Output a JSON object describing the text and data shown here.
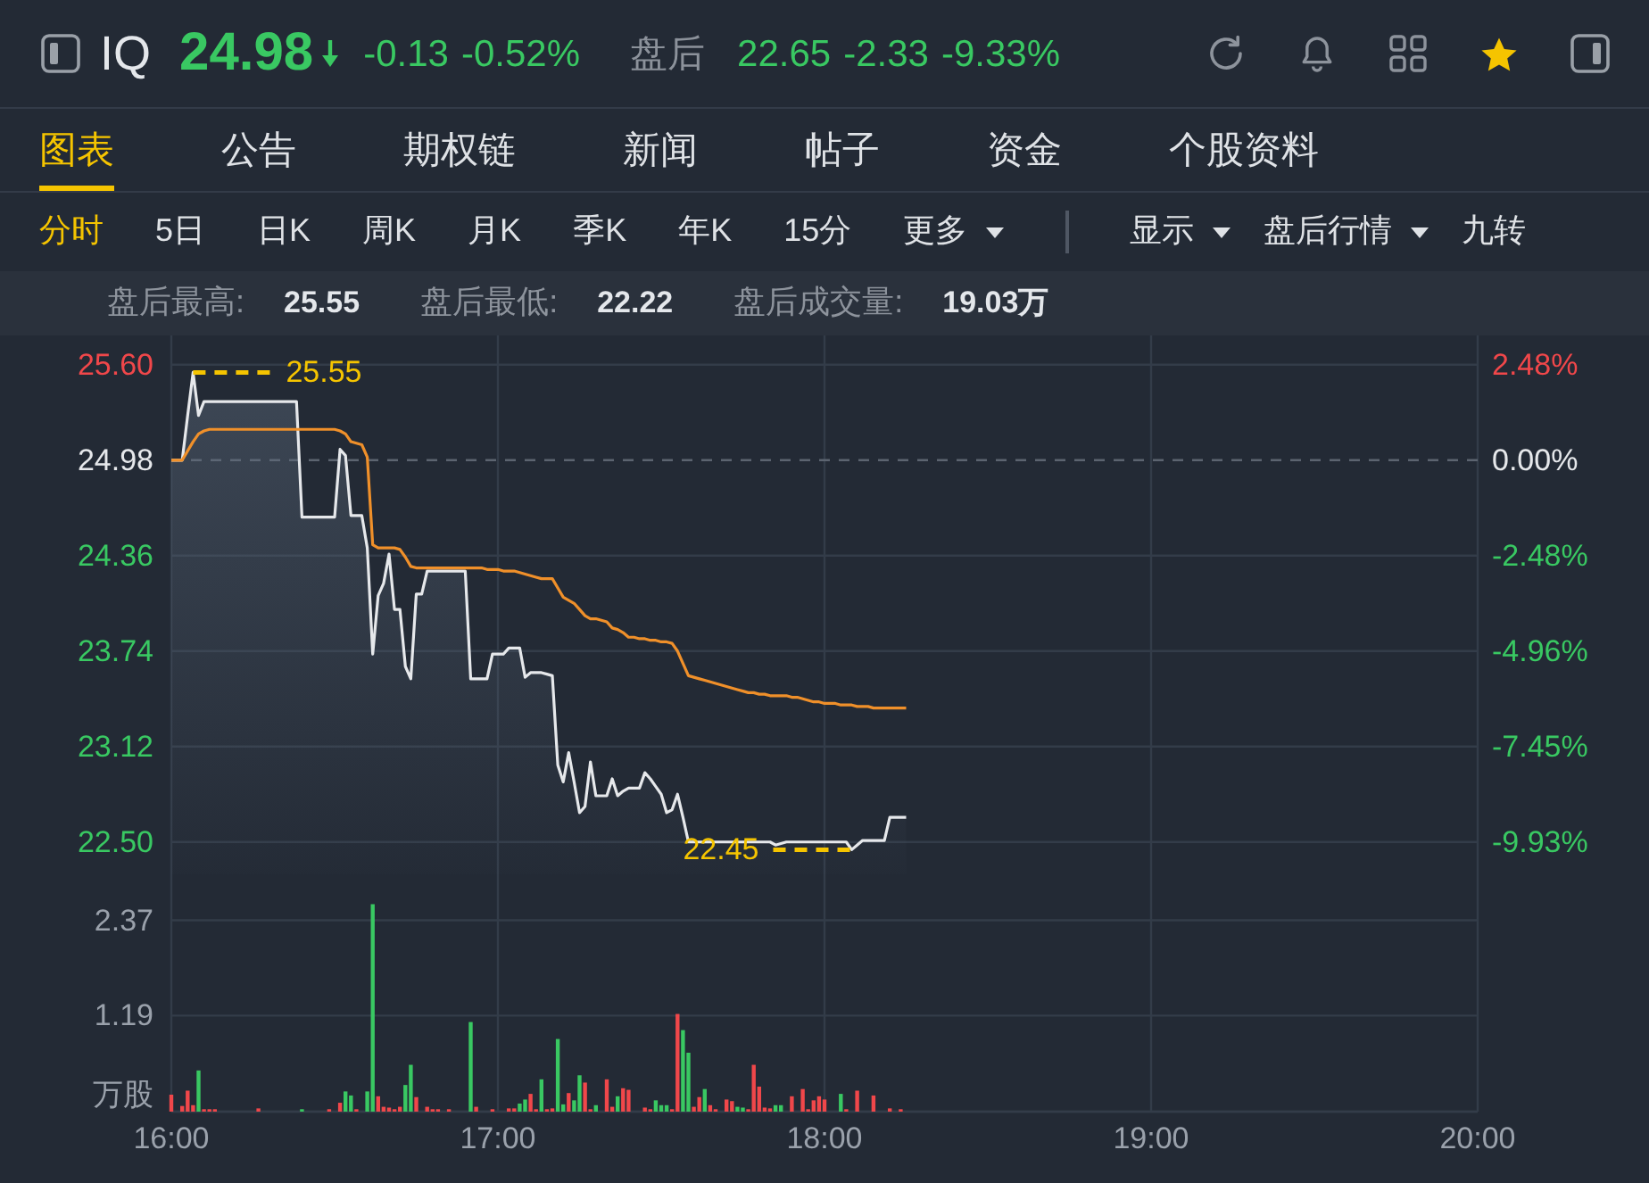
{
  "quote": {
    "symbol": "IQ",
    "price": "24.98",
    "rising": false,
    "change": "-0.13",
    "change_percent": "-0.52%",
    "after_hours_label": "盘后",
    "after_hours_price": "22.65",
    "after_hours_rising": false,
    "after_hours_change": "-2.33",
    "after_hours_change_percent": "-9.33%",
    "favorited": true
  },
  "tabs": [
    {
      "label": "图表",
      "selected": true
    },
    {
      "label": "公告",
      "selected": false
    },
    {
      "label": "期权链",
      "selected": false
    },
    {
      "label": "新闻",
      "selected": false
    },
    {
      "label": "帖子",
      "selected": false
    },
    {
      "label": "资金",
      "selected": false
    },
    {
      "label": "个股资料",
      "selected": false
    }
  ],
  "periods": [
    {
      "label": "分时",
      "selected": true,
      "dropdown": false
    },
    {
      "label": "5日",
      "selected": false,
      "dropdown": false
    },
    {
      "label": "日K",
      "selected": false,
      "dropdown": false
    },
    {
      "label": "周K",
      "selected": false,
      "dropdown": false
    },
    {
      "label": "月K",
      "selected": false,
      "dropdown": false
    },
    {
      "label": "季K",
      "selected": false,
      "dropdown": false
    },
    {
      "label": "年K",
      "selected": false,
      "dropdown": false
    },
    {
      "label": "15分",
      "selected": false,
      "dropdown": false
    },
    {
      "label": "更多",
      "selected": false,
      "dropdown": true
    }
  ],
  "options": [
    {
      "label": "显示",
      "dropdown": true
    },
    {
      "label": "盘后行情",
      "dropdown": true
    },
    {
      "label": "九转",
      "dropdown": false
    }
  ],
  "stats": [
    {
      "label": "盘后最高:",
      "value": "25.55"
    },
    {
      "label": "盘后最低:",
      "value": "22.22"
    },
    {
      "label": "盘后成交量:",
      "value": "19.03万"
    }
  ],
  "price_chart": {
    "percent_labels": [
      "2.48%",
      "0.00%",
      "-2.48%",
      "-4.96%",
      "-7.45%",
      "-9.93%"
    ],
    "chart_data": {
      "type": "line",
      "grid": true,
      "categories": [
        null,
        null,
        null,
        null,
        null,
        null,
        null,
        null,
        null,
        null,
        null,
        null,
        null,
        null,
        null,
        null,
        null,
        null,
        null,
        null,
        null,
        null,
        null,
        null,
        null,
        null,
        null,
        null,
        null,
        null,
        null,
        null,
        null,
        null,
        null,
        null,
        null,
        null,
        null,
        null,
        null,
        null,
        null,
        null,
        null,
        null,
        null,
        null,
        null,
        null,
        null,
        null,
        null,
        null,
        null,
        null,
        null,
        null,
        null,
        null,
        null,
        null,
        null,
        null,
        null,
        null,
        null,
        null,
        null,
        null,
        null,
        null,
        null,
        null,
        null,
        null,
        null,
        null,
        null,
        null,
        null,
        null,
        null,
        null,
        null,
        null,
        null,
        null,
        null,
        null,
        null,
        null,
        null,
        null,
        null,
        null,
        null,
        null,
        null,
        null,
        null,
        null,
        null,
        null,
        null,
        null,
        null,
        null,
        null,
        null,
        null,
        null,
        null,
        null,
        null,
        null,
        null,
        null,
        null,
        null,
        null,
        null,
        null,
        null,
        null,
        null,
        null,
        null,
        null,
        null,
        null,
        null,
        null,
        null,
        null,
        null,
        null,
        null,
        null,
        null,
        null,
        null,
        null,
        null,
        null,
        null,
        null,
        null,
        null,
        null,
        null,
        null,
        null,
        null,
        null,
        null,
        null,
        null,
        null,
        null,
        null,
        null,
        null,
        null,
        null,
        null,
        null,
        null,
        null,
        null,
        null,
        null,
        null,
        null,
        null,
        null,
        null,
        null,
        null,
        null,
        null,
        null,
        null,
        null,
        null,
        null,
        null,
        null,
        null,
        null,
        null,
        null,
        null,
        null,
        null,
        null,
        null,
        null,
        null,
        null,
        null,
        null,
        null,
        null,
        null,
        null,
        null,
        null,
        null,
        null,
        null,
        null,
        null,
        null,
        null,
        null,
        null,
        null,
        null,
        null,
        null,
        null,
        null,
        null,
        null,
        null,
        null,
        null,
        null,
        null,
        null,
        null,
        null,
        null,
        null,
        null,
        null,
        null,
        null,
        null,
        null
      ],
      "series": [
        {
          "color": "#e6e8eb",
          "values": [
            24.98,
            24.98,
            24.98,
            25.27,
            25.55,
            25.27,
            25.36,
            25.36,
            25.36,
            25.36,
            25.36,
            25.36,
            25.36,
            25.36,
            25.36,
            25.36,
            25.36,
            25.36,
            25.36,
            25.36,
            25.36,
            25.36,
            25.36,
            25.36,
            24.61,
            24.61,
            24.61,
            24.61,
            24.61,
            24.61,
            24.61,
            25.05,
            25.01,
            24.62,
            24.62,
            24.62,
            24.41,
            23.72,
            24.1,
            24.18,
            24.37,
            24.01,
            24.01,
            23.64,
            23.56,
            24.11,
            24.11,
            24.26,
            24.26,
            24.26,
            24.26,
            24.26,
            24.26,
            24.26,
            24.26,
            23.56,
            23.56,
            23.56,
            23.56,
            23.72,
            23.72,
            23.72,
            23.76,
            23.76,
            23.76,
            23.57,
            23.6,
            23.6,
            23.6,
            23.59,
            23.58,
            23.0,
            22.89,
            23.08,
            22.89,
            22.69,
            22.73,
            23.02,
            22.8,
            22.8,
            22.8,
            22.91,
            22.8,
            22.83,
            22.85,
            22.85,
            22.85,
            22.95,
            22.91,
            22.86,
            22.81,
            22.69,
            22.71,
            22.81,
            22.66,
            22.5,
            22.5,
            22.5,
            22.5,
            22.5,
            22.5,
            22.5,
            22.5,
            22.5,
            22.5,
            22.5,
            22.5,
            22.5,
            22.5,
            22.5,
            22.5,
            22.48,
            22.49,
            22.5,
            22.5,
            22.5,
            22.5,
            22.5,
            22.5,
            22.5,
            22.5,
            22.5,
            22.5,
            22.5,
            22.5,
            22.45,
            22.48,
            22.51,
            22.51,
            22.51,
            22.51,
            22.51,
            22.66,
            22.66,
            22.66,
            22.66,
            null,
            null,
            null,
            null,
            null,
            null,
            null,
            null,
            null,
            null,
            null,
            null,
            null,
            null,
            null,
            null,
            null,
            null,
            null,
            null,
            null,
            null,
            null,
            null,
            null,
            null,
            null,
            null,
            null,
            null,
            null,
            null,
            null,
            null,
            null,
            null,
            null,
            null,
            null,
            null,
            null,
            null,
            null,
            null,
            null,
            null,
            null,
            null,
            null,
            null,
            null,
            null,
            null,
            null,
            null,
            null,
            null,
            null,
            null,
            null,
            null,
            null,
            null,
            null,
            null,
            null,
            null,
            null,
            null,
            null,
            null,
            null,
            null,
            null,
            null,
            null,
            null,
            null,
            null,
            null,
            null,
            null,
            null,
            null,
            null,
            null,
            null,
            null,
            null,
            null,
            null,
            null,
            null,
            null,
            null,
            null,
            null,
            null,
            null,
            null,
            null,
            null,
            null,
            null,
            null
          ]
        },
        {
          "color": "#f0902a",
          "values": [
            24.98,
            24.98,
            24.98,
            25.04,
            25.1,
            25.15,
            25.17,
            25.18,
            25.18,
            25.18,
            25.18,
            25.18,
            25.18,
            25.18,
            25.18,
            25.18,
            25.18,
            25.18,
            25.18,
            25.18,
            25.18,
            25.18,
            25.18,
            25.18,
            25.18,
            25.18,
            25.18,
            25.18,
            25.18,
            25.18,
            25.18,
            25.17,
            25.15,
            25.1,
            25.09,
            25.08,
            25.0,
            24.43,
            24.41,
            24.41,
            24.41,
            24.41,
            24.4,
            24.35,
            24.29,
            24.28,
            24.28,
            24.28,
            24.28,
            24.28,
            24.28,
            24.28,
            24.28,
            24.28,
            24.28,
            24.28,
            24.28,
            24.28,
            24.27,
            24.27,
            24.27,
            24.26,
            24.26,
            24.26,
            24.25,
            24.24,
            24.23,
            24.22,
            24.21,
            24.21,
            24.21,
            24.15,
            24.09,
            24.07,
            24.05,
            24.01,
            23.97,
            23.95,
            23.95,
            23.94,
            23.93,
            23.89,
            23.88,
            23.86,
            23.83,
            23.83,
            23.82,
            23.82,
            23.81,
            23.81,
            23.8,
            23.8,
            23.79,
            23.74,
            23.66,
            23.58,
            23.57,
            23.56,
            23.55,
            23.54,
            23.53,
            23.52,
            23.51,
            23.5,
            23.49,
            23.48,
            23.47,
            23.47,
            23.46,
            23.46,
            23.45,
            23.45,
            23.45,
            23.45,
            23.44,
            23.44,
            23.43,
            23.42,
            23.41,
            23.41,
            23.4,
            23.4,
            23.4,
            23.39,
            23.39,
            23.39,
            23.38,
            23.38,
            23.38,
            23.37,
            23.37,
            23.37,
            23.37,
            23.37,
            23.37,
            23.37,
            null,
            null,
            null,
            null,
            null,
            null,
            null,
            null,
            null,
            null,
            null,
            null,
            null,
            null,
            null,
            null,
            null,
            null,
            null,
            null,
            null,
            null,
            null,
            null,
            null,
            null,
            null,
            null,
            null,
            null,
            null,
            null,
            null,
            null,
            null,
            null,
            null,
            null,
            null,
            null,
            null,
            null,
            null,
            null,
            null,
            null,
            null,
            null,
            null,
            null,
            null,
            null,
            null,
            null,
            null,
            null,
            null,
            null,
            null,
            null,
            null,
            null,
            null,
            null,
            null,
            null,
            null,
            null,
            null,
            null,
            null,
            null,
            null,
            null,
            null,
            null,
            null,
            null,
            null,
            null,
            null,
            null,
            null,
            null,
            null,
            null,
            null,
            null,
            null,
            null,
            null,
            null,
            null,
            null,
            null,
            null,
            null,
            null,
            null,
            null,
            null,
            null,
            null,
            null,
            null
          ]
        }
      ],
      "ylim": [
        22.29,
        25.79
      ],
      "yticks": [
        {
          "value": 25.6,
          "label": "25.60"
        },
        {
          "value": 24.98,
          "label": "24.98"
        },
        {
          "value": 24.36,
          "label": "24.36"
        },
        {
          "value": 23.74,
          "label": "23.74"
        },
        {
          "value": 23.12,
          "label": "23.12"
        },
        {
          "value": 22.5,
          "label": "22.50"
        }
      ],
      "ref_lines": [
        {
          "axis": "y",
          "value": 24.98
        }
      ],
      "annotations": [
        "25.55",
        "22.45"
      ]
    }
  },
  "volume_chart": {
    "chart_data": {
      "type": "bar",
      "stacked": true,
      "grid": true,
      "categories": [
        "16:00",
        null,
        null,
        null,
        null,
        null,
        null,
        null,
        null,
        null,
        null,
        null,
        null,
        null,
        null,
        null,
        null,
        null,
        null,
        null,
        null,
        null,
        null,
        null,
        null,
        null,
        null,
        null,
        null,
        null,
        null,
        null,
        null,
        null,
        null,
        null,
        null,
        null,
        null,
        null,
        null,
        null,
        null,
        null,
        null,
        null,
        null,
        null,
        null,
        null,
        null,
        null,
        null,
        null,
        null,
        null,
        null,
        null,
        null,
        null,
        "17:00",
        null,
        null,
        null,
        null,
        null,
        null,
        null,
        null,
        null,
        null,
        null,
        null,
        null,
        null,
        null,
        null,
        null,
        null,
        null,
        null,
        null,
        null,
        null,
        null,
        null,
        null,
        null,
        null,
        null,
        null,
        null,
        null,
        null,
        null,
        null,
        null,
        null,
        null,
        null,
        null,
        null,
        null,
        null,
        null,
        null,
        null,
        null,
        null,
        null,
        null,
        null,
        null,
        null,
        null,
        null,
        null,
        null,
        null,
        null,
        "18:00",
        null,
        null,
        null,
        null,
        null,
        null,
        null,
        null,
        null,
        null,
        null,
        null,
        null,
        null,
        null,
        null,
        null,
        null,
        null,
        null,
        null,
        null,
        null,
        null,
        null,
        null,
        null,
        null,
        null,
        null,
        null,
        null,
        null,
        null,
        null,
        null,
        null,
        null,
        null,
        null,
        null,
        null,
        null,
        null,
        null,
        null,
        null,
        null,
        null,
        null,
        null,
        null,
        null,
        null,
        null,
        null,
        null,
        null,
        null,
        "19:00",
        null,
        null,
        null,
        null,
        null,
        null,
        null,
        null,
        null,
        null,
        null,
        null,
        null,
        null,
        null,
        null,
        null,
        null,
        null,
        null,
        null,
        null,
        null,
        null,
        null,
        null,
        null,
        null,
        null,
        null,
        null,
        null,
        null,
        null,
        null,
        null,
        null,
        null,
        null,
        null,
        null,
        null,
        null,
        null,
        null,
        null,
        null,
        null,
        null,
        null,
        null,
        null,
        null,
        null,
        null,
        null,
        null,
        null,
        null,
        "20:00"
      ],
      "series": [
        {
          "color": "#f0474a",
          "values": [
            0.21,
            null,
            0.07,
            0.26,
            0.08,
            null,
            0.03,
            0.03,
            0.03,
            null,
            null,
            null,
            null,
            null,
            null,
            null,
            0.04,
            null,
            null,
            null,
            null,
            null,
            null,
            null,
            null,
            null,
            null,
            null,
            null,
            0.03,
            null,
            0.11,
            null,
            null,
            0.03,
            null,
            null,
            null,
            0.19,
            0.06,
            0.05,
            0.03,
            0.06,
            null,
            null,
            0.18,
            null,
            0.06,
            0.03,
            0.03,
            null,
            0.03,
            null,
            null,
            null,
            null,
            0.06,
            null,
            null,
            0.03,
            null,
            null,
            0.04,
            0.04,
            null,
            null,
            0.22,
            0.03,
            null,
            0.03,
            0.04,
            null,
            null,
            0.23,
            null,
            null,
            0.36,
            0.03,
            null,
            null,
            0.4,
            0.06,
            null,
            0.29,
            0.27,
            null,
            null,
            0.05,
            0.03,
            null,
            null,
            null,
            0.03,
            1.21,
            null,
            null,
            0.06,
            0.18,
            null,
            0.08,
            0.03,
            null,
            0.15,
            0.13,
            null,
            null,
            0.03,
            0.58,
            0.31,
            0.05,
            0.04,
            null,
            null,
            null,
            0.19,
            null,
            0.28,
            0.03,
            0.14,
            0.19,
            0.15,
            null,
            null,
            null,
            0.03,
            null,
            0.26,
            null,
            null,
            0.2,
            null,
            null,
            0.04,
            null,
            0.03,
            null,
            null,
            null,
            null,
            null,
            null,
            null,
            null,
            null,
            null,
            null,
            null,
            null,
            null,
            null,
            null,
            null,
            null,
            null,
            null,
            null,
            null,
            null,
            null,
            null,
            null,
            null,
            null,
            null,
            null,
            null,
            null,
            null,
            null,
            null,
            null,
            null,
            null,
            null,
            null,
            null,
            null,
            null,
            null,
            null,
            null,
            null,
            null,
            null,
            null,
            null,
            null,
            null,
            null,
            null,
            null,
            null,
            null,
            null,
            null,
            null,
            null,
            null,
            null,
            null,
            null,
            null,
            null,
            null,
            null,
            null,
            null,
            null,
            null,
            null,
            null,
            null,
            null,
            null,
            null,
            null,
            null,
            null,
            null,
            null,
            null,
            null,
            null,
            null,
            null,
            null,
            null,
            null,
            null,
            null,
            null,
            null,
            null,
            null,
            null,
            null,
            null,
            null,
            null,
            null,
            null
          ]
        },
        {
          "color": "#39c862",
          "values": [
            null,
            null,
            null,
            null,
            null,
            0.51,
            null,
            null,
            null,
            null,
            null,
            null,
            null,
            null,
            null,
            null,
            null,
            null,
            null,
            null,
            null,
            null,
            null,
            null,
            0.03,
            null,
            null,
            null,
            null,
            null,
            null,
            null,
            0.25,
            0.2,
            null,
            null,
            0.25,
            2.57,
            null,
            null,
            null,
            null,
            null,
            0.33,
            0.58,
            null,
            null,
            null,
            null,
            null,
            null,
            null,
            null,
            null,
            null,
            1.11,
            null,
            null,
            null,
            null,
            null,
            null,
            null,
            null,
            0.1,
            0.15,
            null,
            null,
            0.4,
            null,
            null,
            0.9,
            0.09,
            null,
            0.14,
            0.45,
            null,
            null,
            0.08,
            null,
            null,
            null,
            0.19,
            null,
            null,
            null,
            null,
            null,
            null,
            0.14,
            0.08,
            0.08,
            null,
            null,
            1.01,
            0.73,
            null,
            null,
            0.28,
            null,
            null,
            null,
            null,
            null,
            0.06,
            0.05,
            null,
            null,
            null,
            null,
            null,
            0.08,
            0.08,
            null,
            null,
            null,
            null,
            null,
            null,
            null,
            null,
            null,
            null,
            0.22,
            null,
            null,
            null,
            null,
            null,
            null,
            null,
            null,
            null,
            null,
            null,
            null,
            null,
            null,
            null,
            null,
            null,
            null,
            null,
            null,
            null,
            null,
            null,
            null,
            null,
            null,
            null,
            null,
            null,
            null,
            null,
            null,
            null,
            null,
            null,
            null,
            null,
            null,
            null,
            null,
            null,
            null,
            null,
            null,
            null,
            null,
            null,
            null,
            null,
            null,
            null,
            null,
            null,
            null,
            null,
            null,
            null,
            null,
            null,
            null,
            null,
            null,
            null,
            null,
            null,
            null,
            null,
            null,
            null,
            null,
            null,
            null,
            null,
            null,
            null,
            null,
            null,
            null,
            null,
            null,
            null,
            null,
            null,
            null,
            null,
            null,
            null,
            null,
            null,
            null,
            null,
            null,
            null,
            null,
            null,
            null,
            null,
            null,
            null,
            null,
            null,
            null,
            null,
            null,
            null,
            null,
            null,
            null,
            null,
            null,
            null,
            null,
            null,
            null,
            null,
            null,
            null
          ]
        }
      ],
      "ylim": [
        0,
        2.94
      ],
      "yticks": [
        {
          "value": 0,
          "label": "万股"
        },
        {
          "value": 1.19,
          "label": "1.19"
        },
        {
          "value": 2.37,
          "label": "2.37"
        }
      ]
    }
  }
}
